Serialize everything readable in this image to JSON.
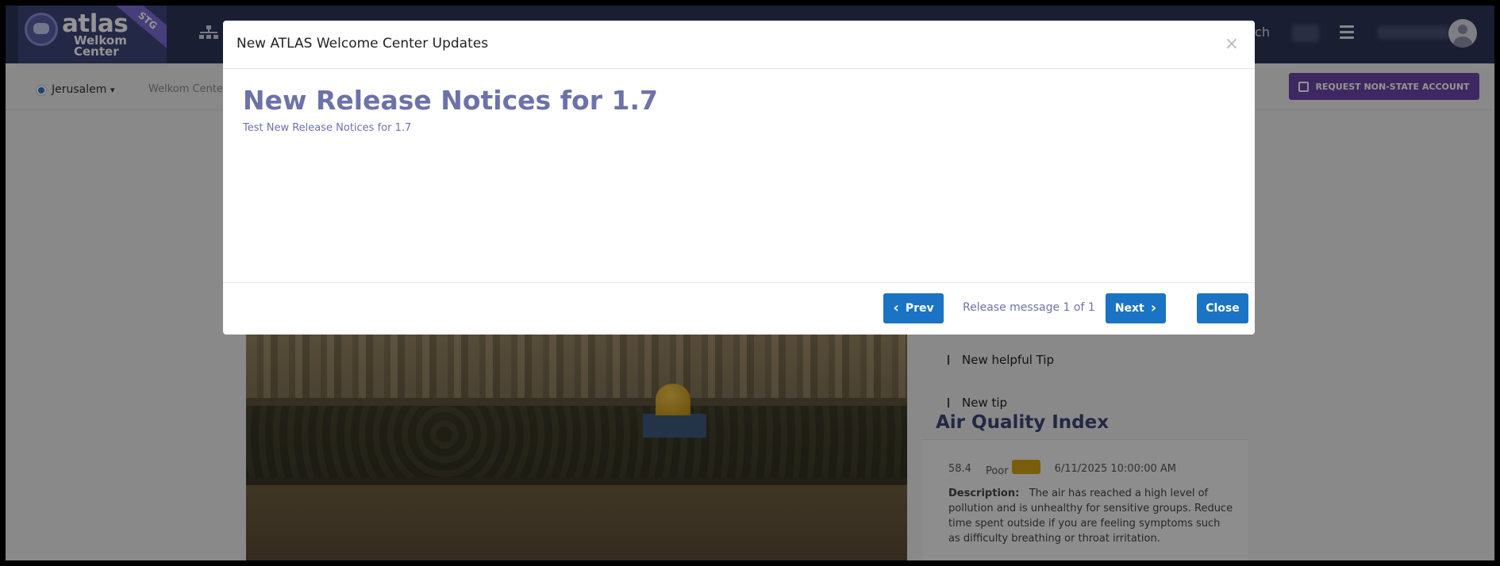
{
  "header": {
    "logo_text": "atlas",
    "logo_sub_1": "Welkom",
    "logo_sub_2": "Center",
    "env_badge": "STG",
    "search_label": "arch"
  },
  "subnav": {
    "location": "Jerusalem",
    "breadcrumb": "Welkom Cente",
    "request_button": "REQUEST NON-STATE ACCOUNT"
  },
  "tips": [
    {
      "label": "New helpful Tip"
    },
    {
      "label": "New tip"
    }
  ],
  "aqi": {
    "title": "Air Quality Index",
    "value": "58.4",
    "status": "Poor",
    "status_color": "#d4a214",
    "timestamp": "6/11/2025 10:00:00 AM",
    "description_label": "Description:",
    "description": "The air has reached a high level of pollution and is unhealthy for sensitive groups. Reduce time spent outside if you are feeling symptoms such as difficulty breathing or throat irritation."
  },
  "modal": {
    "title": "New ATLAS Welcome Center Updates",
    "close_glyph": "×",
    "heading": "New Release Notices for 1.7",
    "subtext": "Test New Release Notices for 1.7",
    "prev_label": "Prev",
    "next_label": "Next",
    "counter": "Release message 1 of 1",
    "close_label": "Close"
  },
  "colors": {
    "header_bg": "#2e3559",
    "accent_purple": "#6a45a8",
    "primary_blue": "#1a73c3",
    "heading_color": "#6d72a8"
  },
  "icons": [
    "org-chart-icon",
    "menu-icon",
    "avatar-icon",
    "pencil-icon",
    "chevron-left-icon",
    "chevron-right-icon",
    "close-icon",
    "chevron-down-icon"
  ]
}
